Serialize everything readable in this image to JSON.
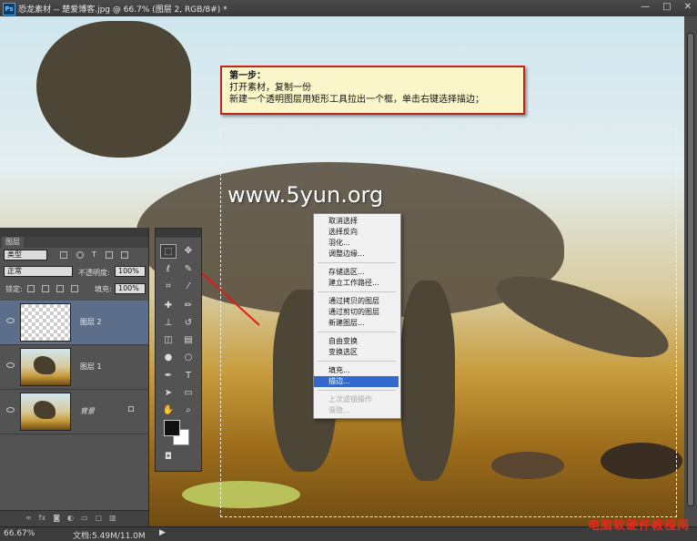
{
  "window": {
    "title": "恐龙素材 -- 楚爱博客.jpg @ 66.7% (图层 2, RGB/8#) *",
    "app_icon": "Ps",
    "controls": [
      "—",
      "□",
      "✕"
    ]
  },
  "annotation": {
    "step_title": "第一步：",
    "line1": "打开素材，复制一份",
    "line2": "新建一个透明图层用矩形工具拉出一个框，单击右键选择描边；"
  },
  "canvas_text": {
    "site": "www.5yun.org"
  },
  "context_menu": {
    "items": [
      {
        "label": "取消选择",
        "state": "normal"
      },
      {
        "label": "选择反向",
        "state": "normal"
      },
      {
        "label": "羽化...",
        "state": "normal"
      },
      {
        "label": "调整边缘...",
        "state": "normal"
      },
      {
        "label": "存储选区...",
        "state": "normal"
      },
      {
        "label": "建立工作路径...",
        "state": "normal"
      },
      {
        "label": "通过拷贝的图层",
        "state": "normal"
      },
      {
        "label": "通过剪切的图层",
        "state": "normal"
      },
      {
        "label": "新建图层...",
        "state": "normal"
      },
      {
        "label": "自由变换",
        "state": "normal"
      },
      {
        "label": "变换选区",
        "state": "normal"
      },
      {
        "label": "填充...",
        "state": "normal"
      },
      {
        "label": "描边...",
        "state": "selected"
      },
      {
        "label": "上次滤镜操作",
        "state": "disabled"
      },
      {
        "label": "渐隐...",
        "state": "disabled"
      }
    ]
  },
  "layers_panel": {
    "tab": "图层",
    "filter_kind": "类型",
    "blend_mode": "正常",
    "opacity_label": "不透明度:",
    "opacity_value": "100%",
    "lock_label": "锁定:",
    "fill_label": "填充:",
    "fill_value": "100%",
    "layers": [
      {
        "name": "图层 2",
        "thumb": "transparent",
        "active": true
      },
      {
        "name": "图层 1",
        "thumb": "image",
        "active": false
      },
      {
        "name": "背景",
        "thumb": "image",
        "active": false,
        "locked": true
      }
    ],
    "footer_icons": [
      "link-icon",
      "fx-icon",
      "mask-icon",
      "adjustment-icon",
      "group-icon",
      "new-layer-icon",
      "trash-icon"
    ]
  },
  "status": {
    "zoom": "66.67%",
    "doc": "文档:5.49M/11.0M",
    "arrow": "▶"
  },
  "watermark": "电脑软硬件教程网",
  "colors": {
    "menu_highlight": "#3369cc",
    "annotation_border": "#c0251d",
    "annotation_bg": "#fbf6c9",
    "watermark": "#e8281a"
  }
}
